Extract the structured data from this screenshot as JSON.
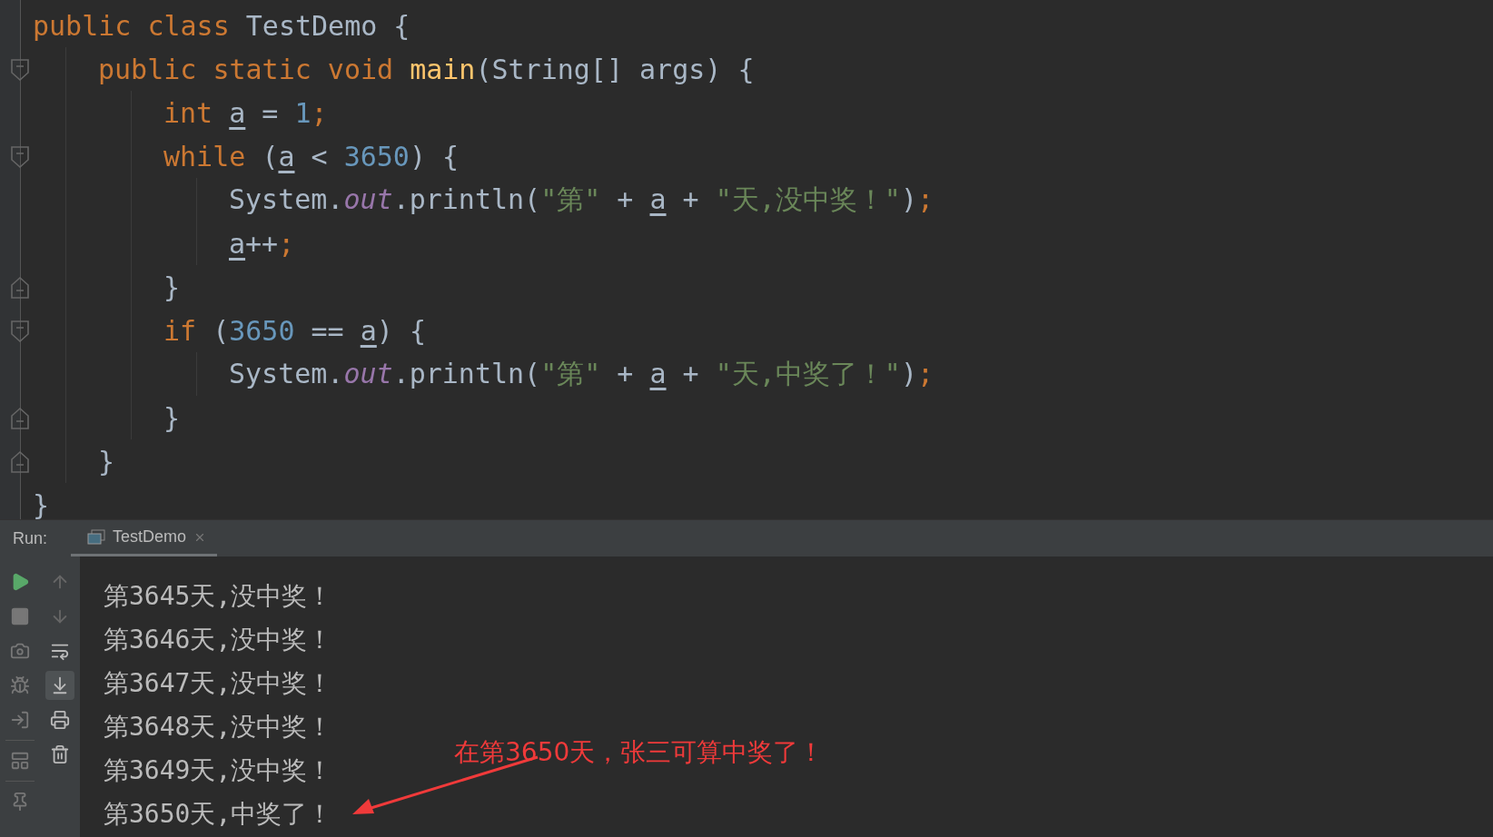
{
  "editor": {
    "code": [
      {
        "tokens": [
          {
            "kind": "kw",
            "text": "public class "
          },
          {
            "kind": "plain",
            "text": "TestDemo {"
          }
        ],
        "close": "}",
        "children": [
          {
            "tokens": [
              {
                "kind": "kw",
                "text": "public static void "
              },
              {
                "kind": "method",
                "text": "main"
              },
              {
                "kind": "plain",
                "text": "(String[] args) {"
              }
            ],
            "close": "}",
            "children": [
              {
                "tokens": [
                  {
                    "kind": "kw",
                    "text": "int "
                  },
                  {
                    "kind": "var",
                    "text": "a"
                  },
                  {
                    "kind": "plain",
                    "text": " = "
                  },
                  {
                    "kind": "num",
                    "text": "1"
                  },
                  {
                    "kind": "semi",
                    "text": ";"
                  }
                ]
              },
              {
                "tokens": [
                  {
                    "kind": "kw",
                    "text": "while "
                  },
                  {
                    "kind": "plain",
                    "text": "("
                  },
                  {
                    "kind": "var",
                    "text": "a"
                  },
                  {
                    "kind": "plain",
                    "text": " < "
                  },
                  {
                    "kind": "num",
                    "text": "3650"
                  },
                  {
                    "kind": "plain",
                    "text": ") {"
                  }
                ],
                "close": "}",
                "children": [
                  {
                    "tokens": [
                      {
                        "kind": "plain",
                        "text": "System."
                      },
                      {
                        "kind": "field",
                        "text": "out"
                      },
                      {
                        "kind": "plain",
                        "text": ".println("
                      },
                      {
                        "kind": "str",
                        "text": "\"第\""
                      },
                      {
                        "kind": "plain",
                        "text": " + "
                      },
                      {
                        "kind": "var",
                        "text": "a"
                      },
                      {
                        "kind": "plain",
                        "text": " + "
                      },
                      {
                        "kind": "str",
                        "text": "\"天,没中奖！\""
                      },
                      {
                        "kind": "plain",
                        "text": ")"
                      },
                      {
                        "kind": "semi",
                        "text": ";"
                      }
                    ]
                  },
                  {
                    "tokens": [
                      {
                        "kind": "var",
                        "text": "a"
                      },
                      {
                        "kind": "plain",
                        "text": "++"
                      },
                      {
                        "kind": "semi",
                        "text": ";"
                      }
                    ]
                  }
                ]
              },
              {
                "tokens": [
                  {
                    "kind": "kw",
                    "text": "if "
                  },
                  {
                    "kind": "plain",
                    "text": "("
                  },
                  {
                    "kind": "num",
                    "text": "3650"
                  },
                  {
                    "kind": "plain",
                    "text": " == "
                  },
                  {
                    "kind": "var",
                    "text": "a"
                  },
                  {
                    "kind": "plain",
                    "text": ") {"
                  }
                ],
                "close": "}",
                "children": [
                  {
                    "tokens": [
                      {
                        "kind": "plain",
                        "text": "System."
                      },
                      {
                        "kind": "field",
                        "text": "out"
                      },
                      {
                        "kind": "plain",
                        "text": ".println("
                      },
                      {
                        "kind": "str",
                        "text": "\"第\""
                      },
                      {
                        "kind": "plain",
                        "text": " + "
                      },
                      {
                        "kind": "var",
                        "text": "a"
                      },
                      {
                        "kind": "plain",
                        "text": " + "
                      },
                      {
                        "kind": "str",
                        "text": "\"天,中奖了！\""
                      },
                      {
                        "kind": "plain",
                        "text": ")"
                      },
                      {
                        "kind": "semi",
                        "text": ";"
                      }
                    ]
                  }
                ]
              }
            ]
          }
        ]
      }
    ]
  },
  "run": {
    "label": "Run:",
    "tabs": [
      {
        "label": "TestDemo",
        "selected": true
      }
    ],
    "tools": [
      {
        "selected": false
      },
      {
        "selected": false
      },
      {
        "selected": false
      },
      {
        "selected": true
      },
      {
        "selected": false
      },
      {
        "selected": false
      }
    ],
    "output": [
      "第3645天,没中奖！",
      "第3646天,没中奖！",
      "第3647天,没中奖！",
      "第3648天,没中奖！",
      "第3649天,没中奖！",
      "第3650天,中奖了！"
    ]
  },
  "annotation": {
    "text": "在第3650天，张三可算中奖了！"
  }
}
